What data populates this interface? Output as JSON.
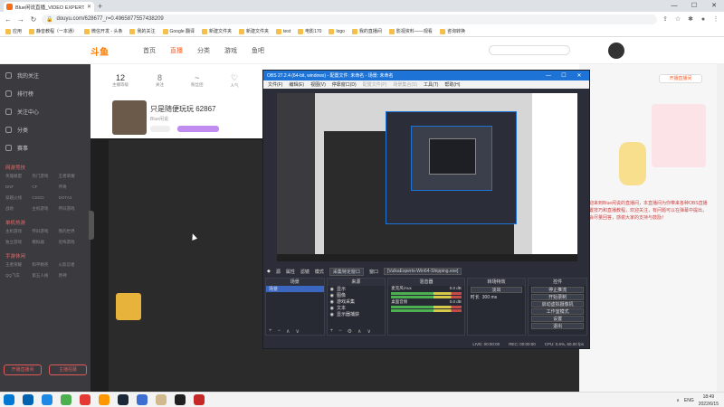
{
  "browser": {
    "tab_title": "Blue闲说直播_VIDEO EXPERT",
    "url": "douyu.com/628677_r=0.4965877557438209",
    "bookmarks": [
      "应用",
      "静音教程（一本通）",
      "微信开发 - 头条",
      "我的关注",
      "Google 翻译",
      "新建文件夹",
      "新建文件夹",
      "test",
      "电影170",
      "logo",
      "我的直播间",
      "影视资料——观看",
      "咨询转换"
    ]
  },
  "site": {
    "logo": "斗鱼",
    "nav": [
      "首页",
      "直播",
      "分类",
      "游戏",
      "鱼吧"
    ],
    "active_nav": "直播",
    "record_button": "开播直播间",
    "stats": [
      {
        "value": "12",
        "label": "主播等级"
      },
      {
        "value": "8",
        "label": "关注"
      },
      {
        "value": "~",
        "label": "粉丝团"
      },
      {
        "value": "♡",
        "label": "人气"
      }
    ],
    "streamer_name": "只是随便玩玩 62867",
    "streamer_sub": "Blue闲说",
    "streamer_sub2": "房间号 直播",
    "right_text": "欢迎来到Blue闲说的直播间，本直播间为你带来各种OBS直播设置技巧和直播教程，欢迎关注，有问题可以在弹幕中提出，我会尽量回答，感谢大家的支持与鼓励！",
    "sidebar": {
      "items": [
        "我的关注",
        "排行榜",
        "关注中心",
        "分类",
        "赛事"
      ],
      "head1": "网游竞技",
      "grid1": [
        "英雄联盟",
        "热门游戏",
        "王者荣耀",
        "DNF",
        "CF",
        "传奇",
        "穿越火线",
        "CSGO",
        "DOTA2",
        "战地",
        "主机游戏",
        "怀旧游戏"
      ],
      "head2": "单机热游",
      "grid2": [
        "主机游戏",
        "怀旧游戏",
        "我的世界",
        "独立游戏",
        "模拟器",
        "恐怖游戏"
      ],
      "head3": "手游休闲",
      "grid3": [
        "王者荣耀",
        "和平精英",
        "火影忍者",
        "QQ飞车",
        "第五人格",
        "原神"
      ],
      "btn_a": "开播直播间",
      "btn_b": "主播招募"
    }
  },
  "obs": {
    "title": "OBS 27.2.4 (64-bit, windows) - 配置文件: 未命名 - 场景: 未命名",
    "menu": [
      "文件(F)",
      "编辑(E)",
      "视图(V)",
      "停靠窗口(D)",
      "配置文件(P)",
      "场景集合(S)",
      "工具(T)",
      "帮助(H)"
    ],
    "dim_menus": [
      "配置文件(P)",
      "场景集合(S)"
    ],
    "ctx_icon": "◆",
    "ctx_label": "源",
    "ctx_props": "属性",
    "ctx_filters": "滤镜",
    "ctx_mode_label": "模式",
    "ctx_mode_value": "采集特定窗口",
    "ctx_window_label": "窗口",
    "ctx_window_value": "[VulkaExperts-Win64-Shipping.exe]",
    "docks": {
      "scenes": {
        "title": "场景",
        "rows": [
          "场景"
        ]
      },
      "sources": {
        "title": "来源",
        "rows": [
          "显示",
          "图像",
          "游戏采集",
          "文本",
          "显示器捕获"
        ]
      },
      "mixer": {
        "title": "混音器",
        "rows": [
          {
            "name": "麦克风/Aux",
            "db": "0.0 dB"
          },
          {
            "name": "桌面音频",
            "db": "0.0 dB"
          }
        ]
      },
      "transitions": {
        "title": "转场特效",
        "fade": "淡出",
        "duration_label": "时长",
        "duration": "300 ms"
      },
      "controls": {
        "title": "控件",
        "buttons": [
          "停止推流",
          "开始录制",
          "启动虚拟摄像机",
          "工作室模式",
          "设置",
          "退出"
        ]
      }
    },
    "status": [
      "LIVE: 00:00:00",
      "REC: 00:00:00",
      "CPU: 0.6%, 60.00 fps"
    ]
  },
  "taskbar": {
    "icon_colors": [
      "#0063b1",
      "#1e88e5",
      "#4caf50",
      "#e53935",
      "#ff9800",
      "#1b2838",
      "#3c6fd1",
      "#d0b98d",
      "#202020",
      "#c62828"
    ],
    "tray": [
      "∧",
      "ENG"
    ],
    "time": "18:49",
    "date": "2022/6/15"
  },
  "colors": {
    "accent": "#ff5d23",
    "obs_title": "#1d74d6"
  }
}
